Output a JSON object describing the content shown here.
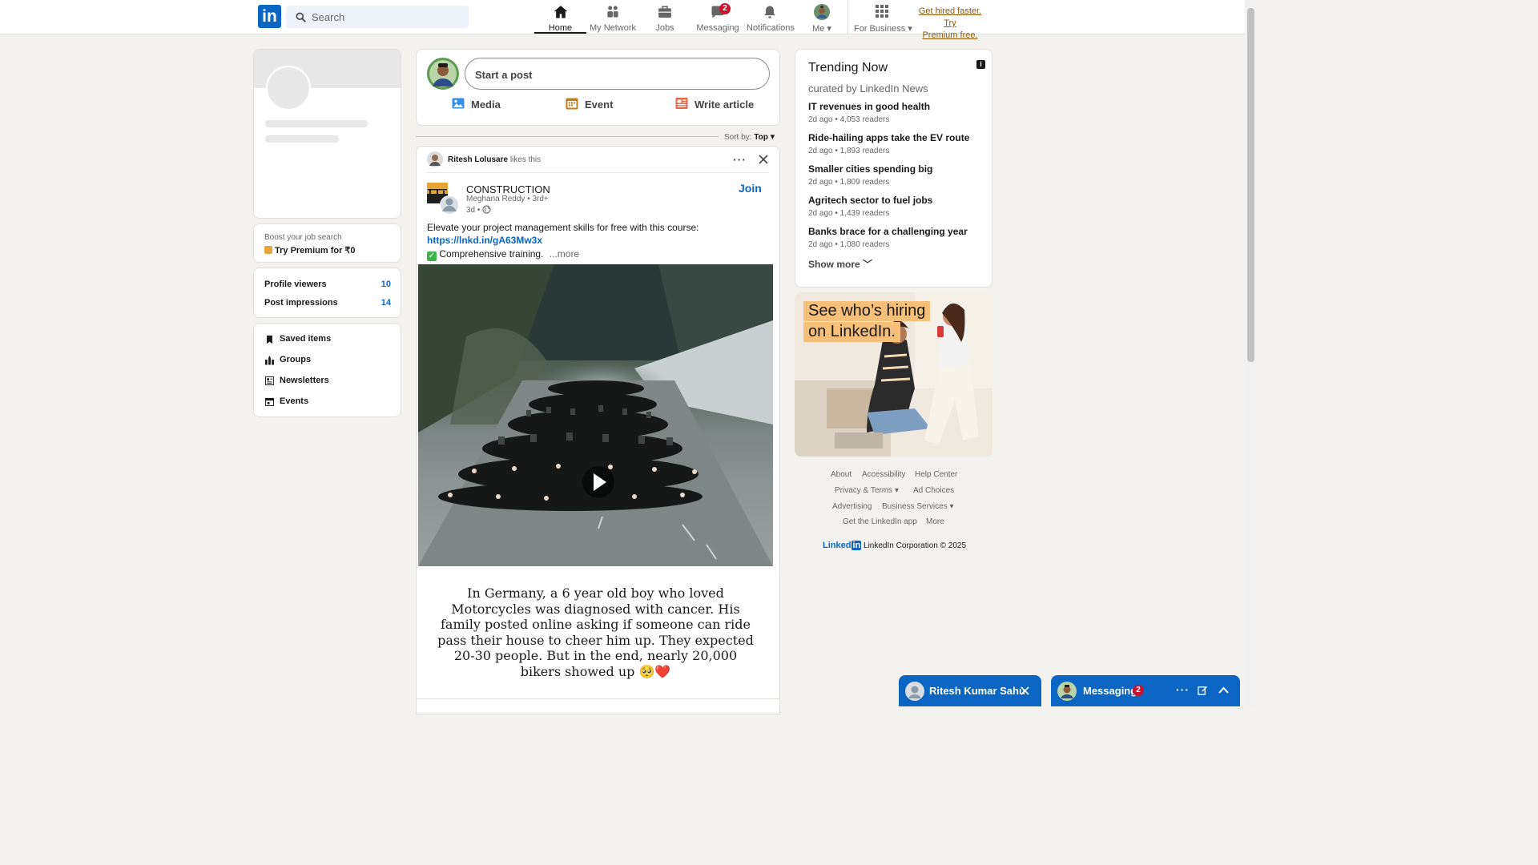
{
  "nav": {
    "logo": "in",
    "search_placeholder": "Search",
    "items": [
      {
        "label": "Home"
      },
      {
        "label": "My Network"
      },
      {
        "label": "Jobs"
      },
      {
        "label": "Messaging",
        "badge": "2"
      },
      {
        "label": "Notifications"
      },
      {
        "label": "Me"
      },
      {
        "label": "For Business"
      }
    ],
    "premium_line1": "Get hired faster. Try",
    "premium_line2": "Premium free."
  },
  "left": {
    "boost_text": "Boost your job search",
    "premium_cta": "Try Premium for ₹0",
    "stats": [
      {
        "label": "Profile viewers",
        "value": "10"
      },
      {
        "label": "Post impressions",
        "value": "14"
      }
    ],
    "shortcuts": [
      "Saved items",
      "Groups",
      "Newsletters",
      "Events"
    ]
  },
  "composer": {
    "placeholder": "Start a post",
    "actions": [
      {
        "label": "Media",
        "icon": "media-icon",
        "color": "#378fe9"
      },
      {
        "label": "Event",
        "icon": "calendar-icon",
        "color": "#c37d16"
      },
      {
        "label": "Write article",
        "icon": "article-icon",
        "color": "#e06847"
      }
    ]
  },
  "sort": {
    "label": "Sort by:",
    "value": "Top"
  },
  "post": {
    "liker_name": "Ritesh Lolusare",
    "liker_action": "likes this",
    "group_name": "CONSTRUCTION",
    "author_meta": "Meghana Reddy • 3rd+",
    "time": "3d •",
    "join_label": "Join",
    "text_line1": "Elevate your project management skills for free with this course:",
    "link": "https://lnkd.in/gA63Mw3x",
    "text_line3": "Comprehensive training.",
    "more_label": "...more",
    "image_caption": [
      "In Germany, a 6 year old boy who loved",
      "Motorcycles was diagnosed with cancer.  His",
      "family posted online asking if  someone can ride",
      "pass their house to cheer  him up. They expected",
      "20-30 people.  But in the end, nearly 20,000",
      "bikers showed up 🥺❤️"
    ]
  },
  "trending": {
    "title": "Trending Now",
    "subtitle": "curated by LinkedIn News",
    "items": [
      {
        "title": "IT revenues in good health",
        "meta": "2d ago • 4,053 readers"
      },
      {
        "title": "Ride-hailing apps take the EV route",
        "meta": "2d ago • 1,893 readers"
      },
      {
        "title": "Smaller cities spending big",
        "meta": "2d ago • 1,809 readers"
      },
      {
        "title": "Agritech sector to fuel jobs",
        "meta": "2d ago • 1,439 readers"
      },
      {
        "title": "Banks brace for a challenging year",
        "meta": "2d ago • 1,080 readers"
      }
    ],
    "show_more": "Show more"
  },
  "ad": {
    "line1": "See who’s hiring",
    "line2": "on LinkedIn."
  },
  "footer": {
    "links": [
      "About",
      "Accessibility",
      "Help Center",
      "Privacy & Terms",
      "Ad Choices",
      "Advertising",
      "Business Services",
      "Get the LinkedIn app",
      "More"
    ],
    "brand": "Linked",
    "brand_in": "in",
    "copyright": "LinkedIn Corporation © 2025"
  },
  "chat": {
    "conversation_name": "Ritesh Kumar Sahu",
    "messaging_label": "Messaging",
    "messaging_badge": "2"
  }
}
